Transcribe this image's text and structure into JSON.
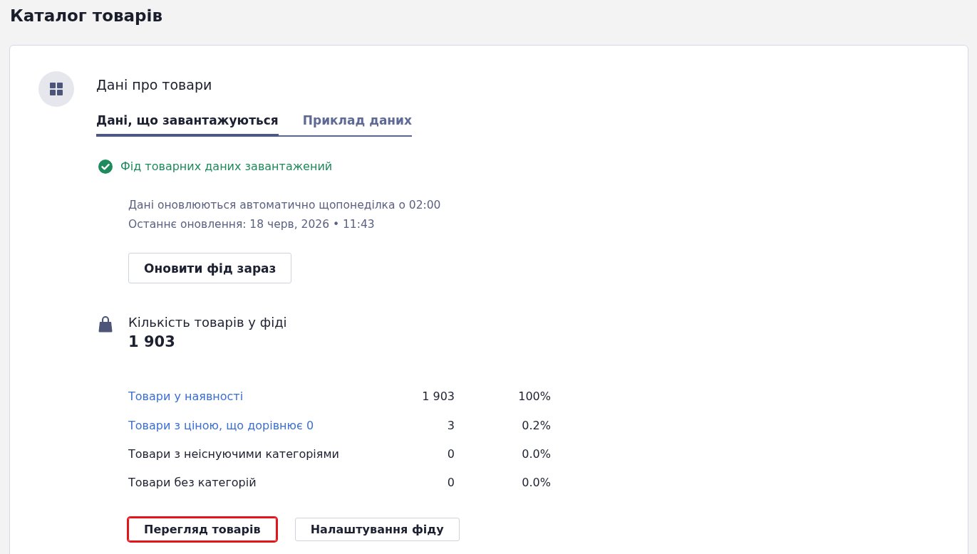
{
  "page": {
    "title": "Каталог товарів"
  },
  "card": {
    "title": "Дані про товари",
    "tabs": [
      {
        "label": "Дані, що завантажуються",
        "selected": true
      },
      {
        "label": "Приклад даних",
        "selected": false
      }
    ],
    "status": {
      "text": "Фід товарних даних завантажений"
    },
    "info_lines": [
      "Дані оновлюються автоматично щопонеділка о 02:00",
      "Останнє оновлення: 18 черв, 2026 • 11:43"
    ],
    "refresh_button": "Оновити фід зараз",
    "product_count": {
      "label": "Кількість товарів у фіді",
      "value": "1 903"
    },
    "stats": [
      {
        "kind": "link",
        "label": "Товари у наявності",
        "count": "1 903",
        "percent": "100%"
      },
      {
        "kind": "link",
        "label": "Товари з ціною, що дорівнює 0",
        "count": "3",
        "percent": "0.2%"
      },
      {
        "kind": "plain",
        "label": "Товари з неіснуючими категоріями",
        "count": "0",
        "percent": "0.0%"
      },
      {
        "kind": "plain",
        "label": "Товари без категорій",
        "count": "0",
        "percent": "0.0%"
      }
    ],
    "buttons": [
      {
        "label": "Перегляд товарів",
        "highlighted": true
      },
      {
        "label": "Налаштування фіду",
        "highlighted": false
      }
    ]
  }
}
